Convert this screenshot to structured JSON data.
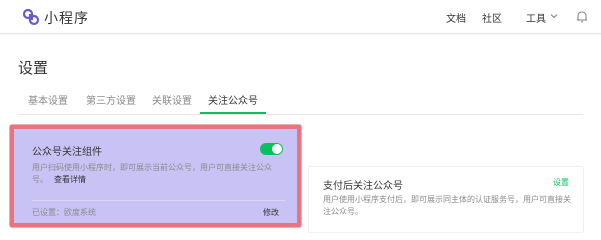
{
  "header": {
    "app_name": "小程序",
    "nav": {
      "docs": "文档",
      "community": "社区",
      "tools": "工具"
    }
  },
  "page": {
    "title": "设置",
    "tabs": [
      {
        "label": "基本设置",
        "active": false
      },
      {
        "label": "第三方设置",
        "active": false
      },
      {
        "label": "关联设置",
        "active": false
      },
      {
        "label": "关注公众号",
        "active": true
      }
    ]
  },
  "cards": {
    "follow_component": {
      "title": "公众号关注组件",
      "toggle_on": true,
      "description": "用户扫码使用小程序时，即可展示当前公众号，用户可直接关注公众号。",
      "detail_link": "查看详情",
      "status": "已设置：欧度系统",
      "edit_label": "修改"
    },
    "follow_after_pay": {
      "title": "支付后关注公众号",
      "set_label": "设置",
      "description": "用户使用小程序支付后，即可展示同主体的认证服务号，用户可直接关注公众号。"
    }
  },
  "colors": {
    "accent": "#07c160",
    "highlight_fill": "#c8c3f4",
    "highlight_border": "#e9737e"
  },
  "icons": {
    "logo": "mini-program-logo",
    "chevron": "chevron-down-icon",
    "bell": "bell-icon"
  }
}
